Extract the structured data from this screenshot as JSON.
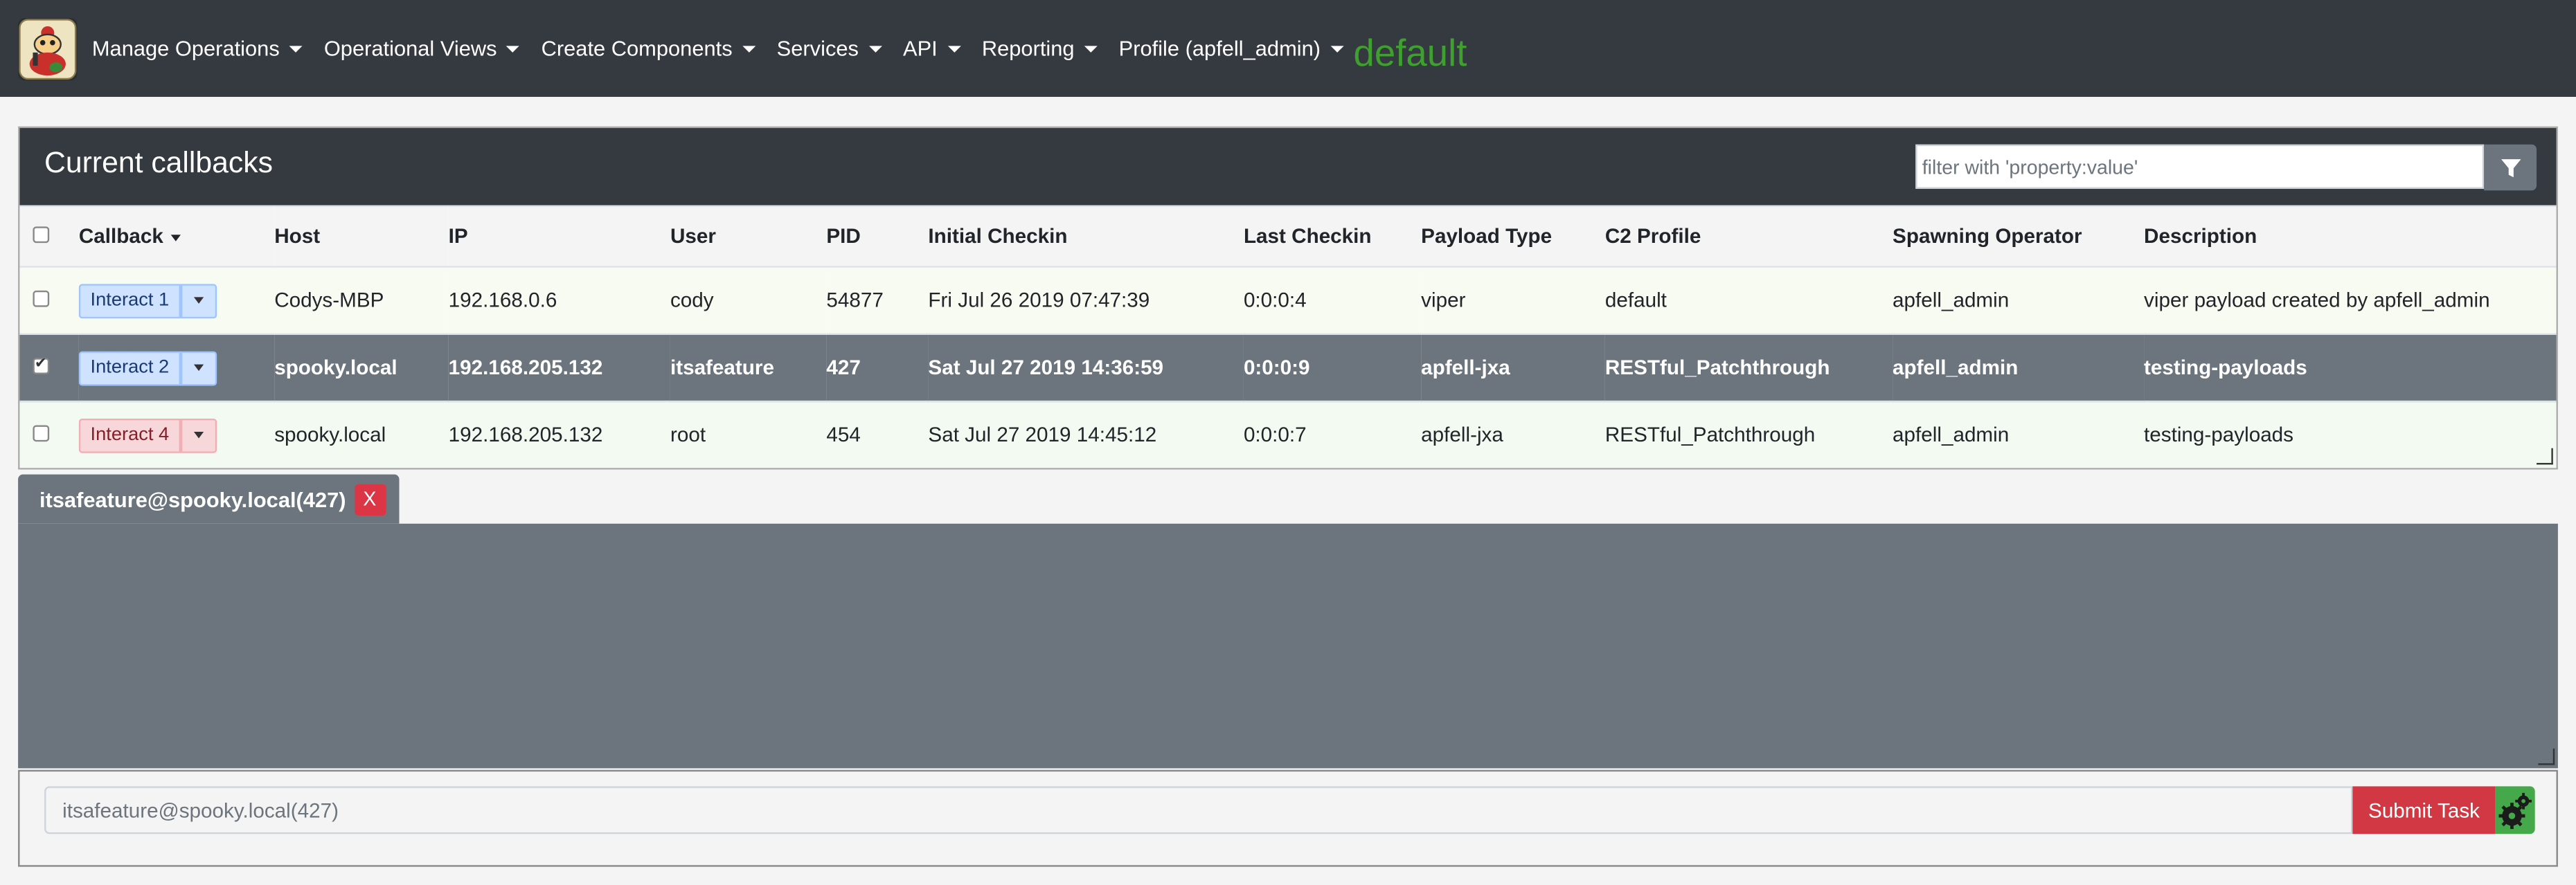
{
  "navbar": {
    "menu": [
      {
        "label": "Manage Operations"
      },
      {
        "label": "Operational Views"
      },
      {
        "label": "Create Components"
      },
      {
        "label": "Services"
      },
      {
        "label": "API"
      },
      {
        "label": "Reporting"
      },
      {
        "label": "Profile (apfell_admin)"
      }
    ],
    "current_operation": "default"
  },
  "callbacks_panel": {
    "title": "Current callbacks",
    "filter_placeholder": "filter with 'property:value'",
    "filter_icon": "filter-icon",
    "columns": [
      "Callback",
      "Host",
      "IP",
      "User",
      "PID",
      "Initial Checkin",
      "Last Checkin",
      "Payload Type",
      "C2 Profile",
      "Spawning Operator",
      "Description"
    ],
    "rows": [
      {
        "checked": false,
        "button": "Interact 1",
        "host": "Codys-MBP",
        "ip": "192.168.0.6",
        "user": "cody",
        "pid": "54877",
        "initial_checkin": "Fri Jul 26 2019 07:47:39",
        "last_checkin": "0:0:0:4",
        "payload_type": "viper",
        "c2_profile": "default",
        "operator": "apfell_admin",
        "description": "viper payload created by apfell_admin"
      },
      {
        "checked": true,
        "button": "Interact 2",
        "host": "spooky.local",
        "ip": "192.168.205.132",
        "user": "itsafeature",
        "pid": "427",
        "initial_checkin": "Sat Jul 27 2019 14:36:59",
        "last_checkin": "0:0:0:9",
        "payload_type": "apfell-jxa",
        "c2_profile": "RESTful_Patchthrough",
        "operator": "apfell_admin",
        "description": "testing-payloads"
      },
      {
        "checked": false,
        "button": "Interact 4",
        "host": "spooky.local",
        "ip": "192.168.205.132",
        "user": "root",
        "pid": "454",
        "initial_checkin": "Sat Jul 27 2019 14:45:12",
        "last_checkin": "0:0:0:7",
        "payload_type": "apfell-jxa",
        "c2_profile": "RESTful_Patchthrough",
        "operator": "apfell_admin",
        "description": "testing-payloads"
      }
    ]
  },
  "tab": {
    "label": "itsafeature@spooky.local(427)",
    "close_label": "X"
  },
  "command_bar": {
    "placeholder": "itsafeature@spooky.local(427)",
    "submit_label": "Submit Task",
    "gear_icon": "gears-icon"
  },
  "colors": {
    "navbar": "#343a40",
    "operation_green": "#3f9f2f",
    "selected_row": "#6c757d",
    "submit_red": "#d13843",
    "gear_green": "#45a84a"
  }
}
